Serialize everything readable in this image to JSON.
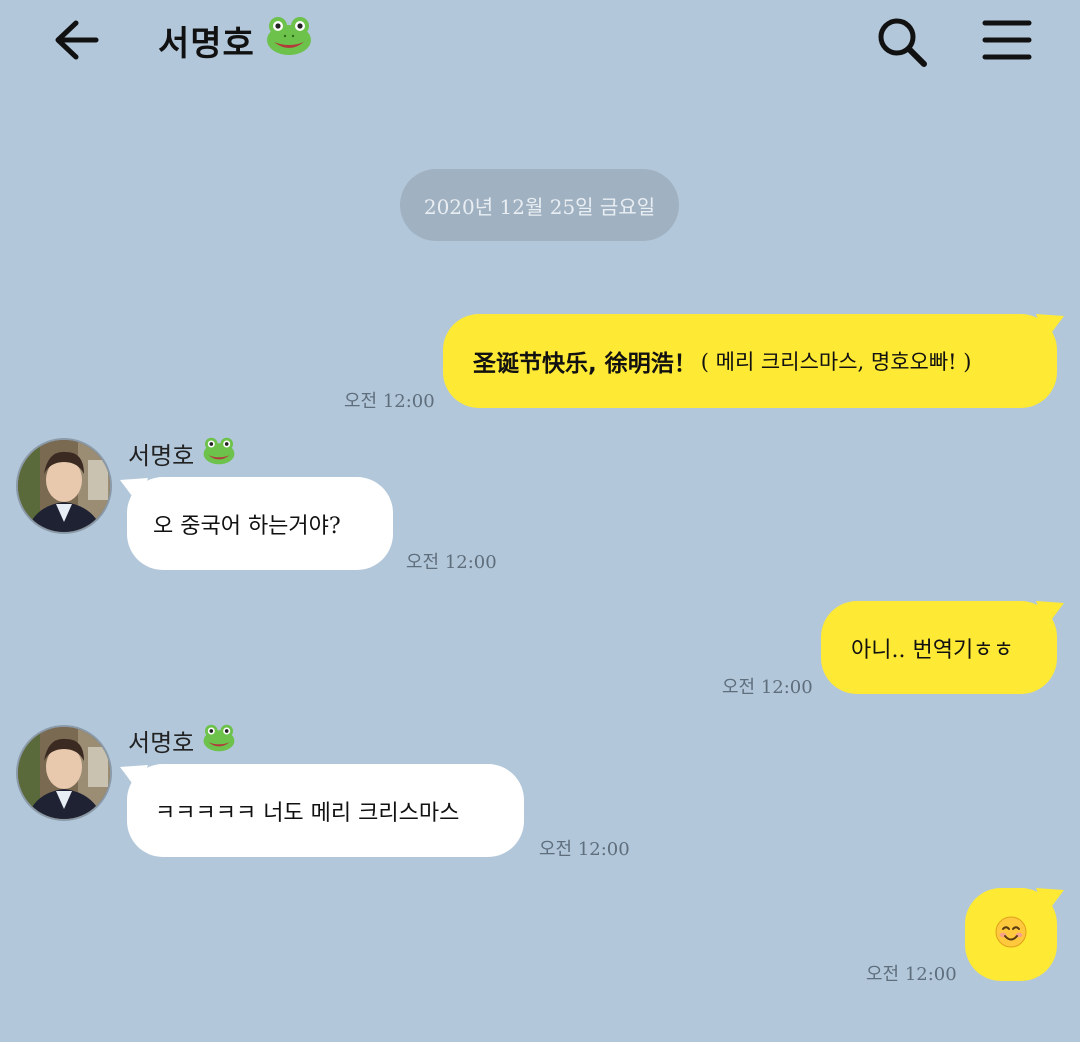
{
  "header": {
    "title": "서명호",
    "title_emoji": "frog-icon",
    "back_icon": "back-arrow-icon",
    "search_icon": "search-icon",
    "menu_icon": "hamburger-menu-icon"
  },
  "date_divider": "2020년 12월 25일 금요일",
  "messages": [
    {
      "from": "me",
      "text": "圣诞节快乐, 徐明浩！",
      "text_suffix": "( 메리 크리스마스, 명호오빠! )",
      "time": "오전 12:00"
    },
    {
      "from": "서명호",
      "sender": "서명호",
      "text": "오 중국어 하는거야?",
      "time": "오전 12:00"
    },
    {
      "from": "me",
      "text": "아니.. 번역기ㅎㅎ",
      "time": "오전 12:00"
    },
    {
      "from": "서명호",
      "sender": "서명호",
      "text": "ㅋㅋㅋㅋㅋ 너도 메리 크리스마스",
      "time": "오전 12:00"
    },
    {
      "from": "me",
      "emoji": "smiling-face-icon",
      "time": "오전 12:00"
    }
  ],
  "colors": {
    "background": "#b2c7da",
    "my_bubble": "#fee935",
    "their_bubble": "#ffffff",
    "date_pill": "#a0b1c1"
  }
}
